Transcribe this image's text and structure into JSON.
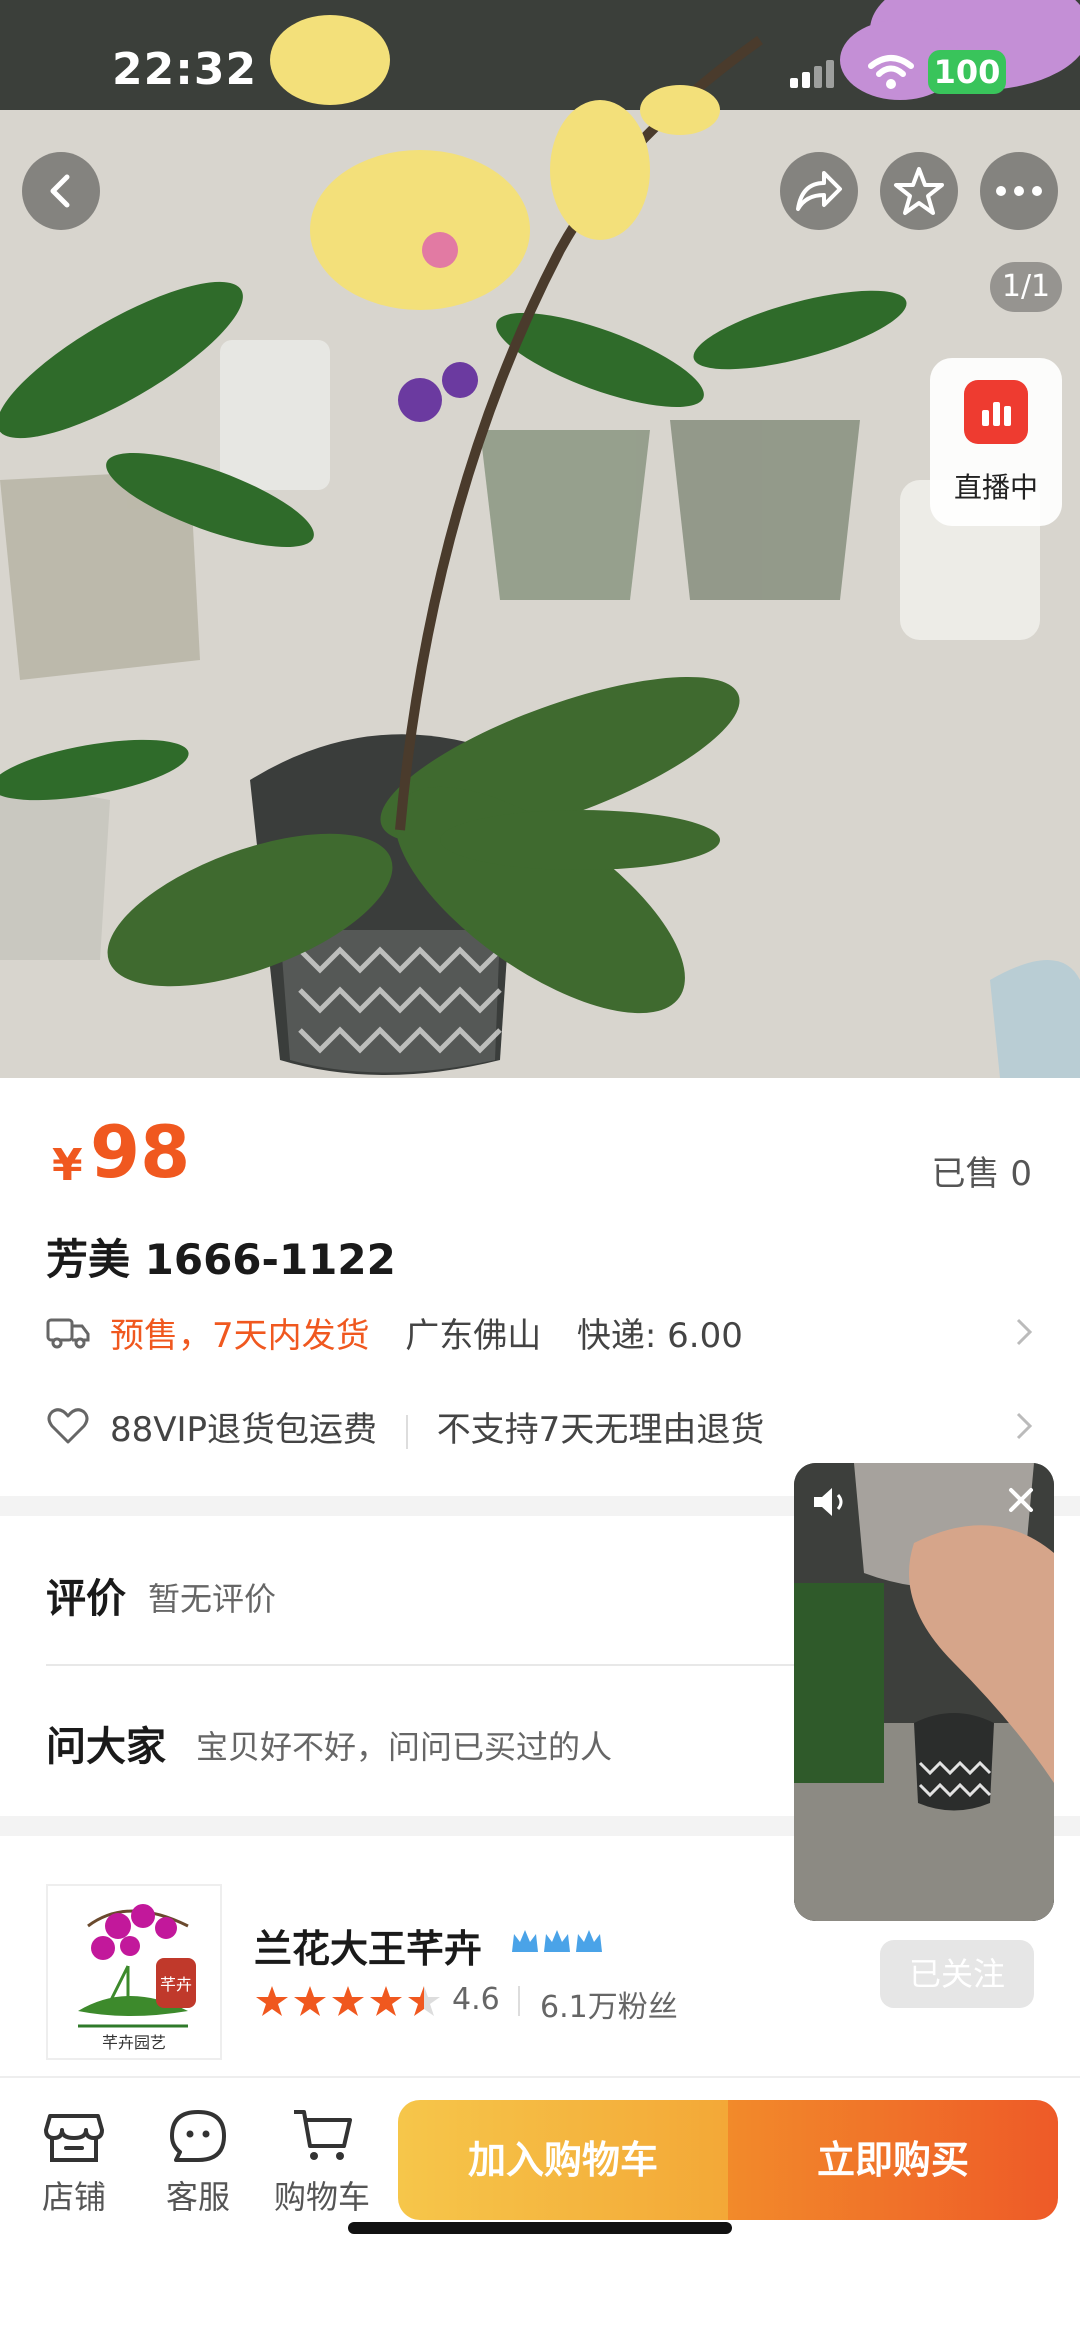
{
  "status_bar": {
    "time": "22:32",
    "battery": "100"
  },
  "gallery": {
    "counter": "1/1",
    "live_label": "直播中"
  },
  "product": {
    "currency": "¥",
    "price": "98",
    "sold": "已售 0",
    "title": "芳美 1666-1122"
  },
  "shipping": {
    "presale": "预售，7天内发货",
    "origin": "广东佛山",
    "fee": "快递: 6.00"
  },
  "service": {
    "return_shipping": "88VIP退货包运费",
    "no_return": "不支持7天无理由退货"
  },
  "reviews": {
    "label": "评价",
    "value": "暂无评价"
  },
  "qa": {
    "label": "问大家",
    "hint": "宝贝好不好，问问已买过的人"
  },
  "shop": {
    "name": "兰花大王芊卉",
    "logo_text": "芊卉园艺",
    "rating": "4.6",
    "fans": "6.1万粉丝",
    "follow_label": "已关注",
    "stars": 4.5
  },
  "bottom_bar": {
    "store": "店铺",
    "service": "客服",
    "cart": "购物车",
    "add_to_cart": "加入购物车",
    "buy_now": "立即购买"
  },
  "colors": {
    "accent": "#f0581f",
    "live": "#ee3b30",
    "star": "#f0581f"
  }
}
